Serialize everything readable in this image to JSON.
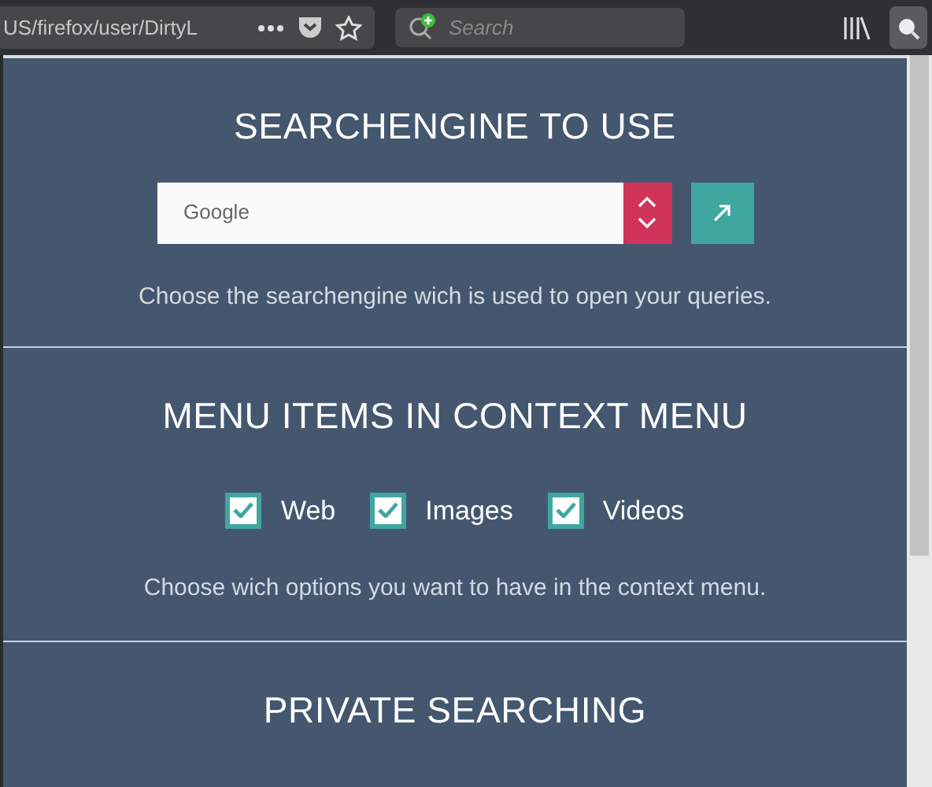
{
  "toolbar": {
    "url": "US/firefox/user/DirtyL",
    "search": {
      "placeholder": "Search"
    }
  },
  "popup": {
    "sections": [
      {
        "kind": "engine",
        "title": "SEARCHENGINE TO USE",
        "engine": {
          "value": "Google"
        },
        "description": "Choose the searchengine wich is used to open your queries."
      },
      {
        "kind": "options",
        "title": "MENU ITEMS IN CONTEXT MENU",
        "options": [
          {
            "label": "Web",
            "checked": true
          },
          {
            "label": "Images",
            "checked": true
          },
          {
            "label": "Videos",
            "checked": true
          }
        ],
        "description": "Choose wich options you want to have in the context menu."
      },
      {
        "kind": "heading",
        "title": "PRIVATE SEARCHING"
      }
    ]
  }
}
